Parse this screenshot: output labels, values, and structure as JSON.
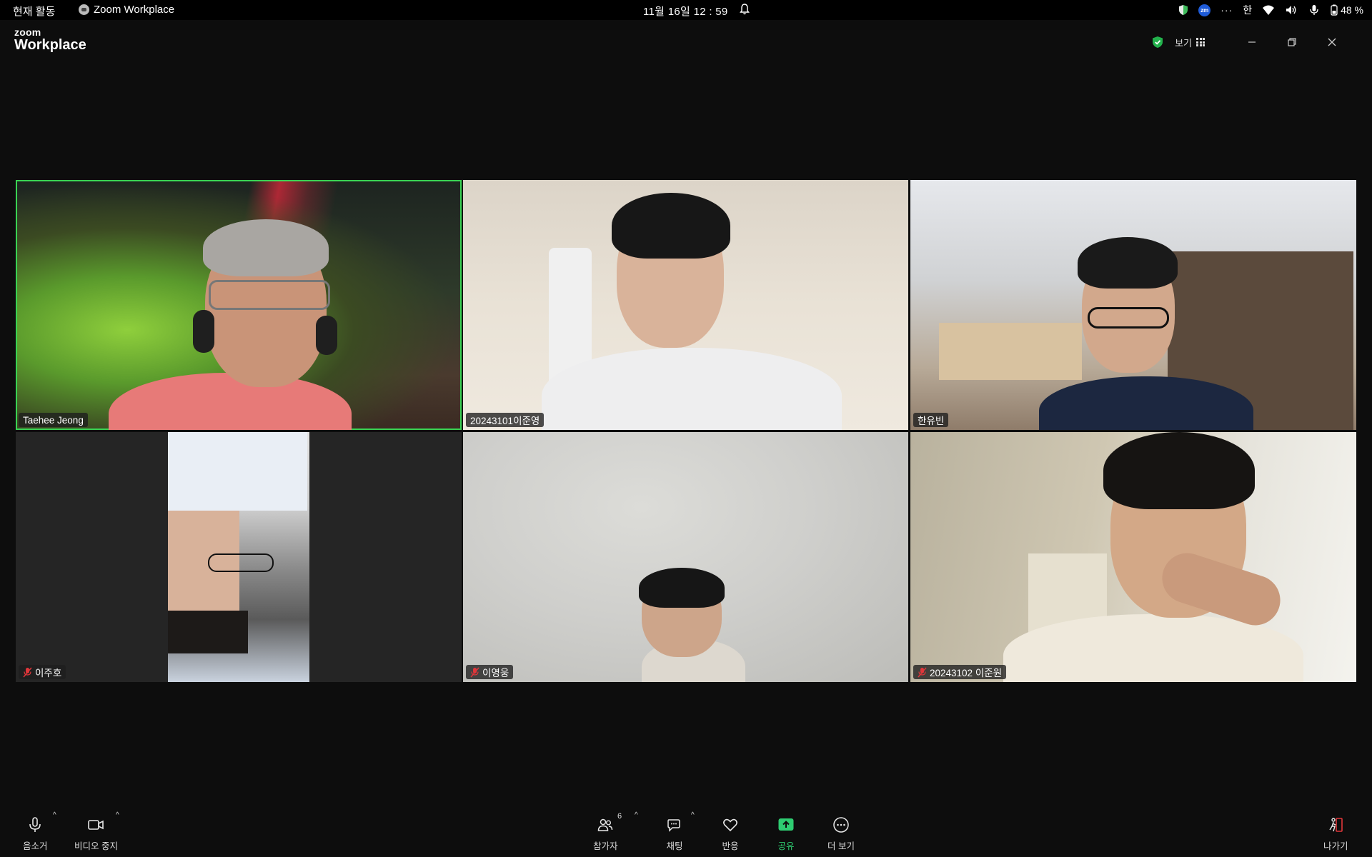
{
  "system_bar": {
    "activities": "현재 활동",
    "app_name": "Zoom Workplace",
    "clock": "11월 16일  12 : 59",
    "input_method": "한",
    "battery": "48 %"
  },
  "titlebar": {
    "logo_small": "zoom",
    "logo_large": "Workplace",
    "view_label": "보기"
  },
  "participants": [
    {
      "name": "Taehee Jeong",
      "muted": false,
      "speaking": true
    },
    {
      "name": "20243101이준영",
      "muted": false,
      "speaking": false
    },
    {
      "name": "한유빈",
      "muted": false,
      "speaking": false
    },
    {
      "name": "이주호",
      "muted": true,
      "speaking": false
    },
    {
      "name": "이영웅",
      "muted": true,
      "speaking": false
    },
    {
      "name": "20243102 이준원",
      "muted": true,
      "speaking": false
    }
  ],
  "toolbar": {
    "mute_label": "음소거",
    "video_label": "비디오 중지",
    "participants_label": "참가자",
    "participants_count": "6",
    "chat_label": "채팅",
    "reactions_label": "반응",
    "share_label": "공유",
    "more_label": "더 보기",
    "leave_label": "나가기"
  },
  "colors": {
    "active_speaker": "#39d353",
    "share_green": "#2ecc71",
    "leave_red": "#e0363a",
    "background": "#0d0d0d"
  }
}
